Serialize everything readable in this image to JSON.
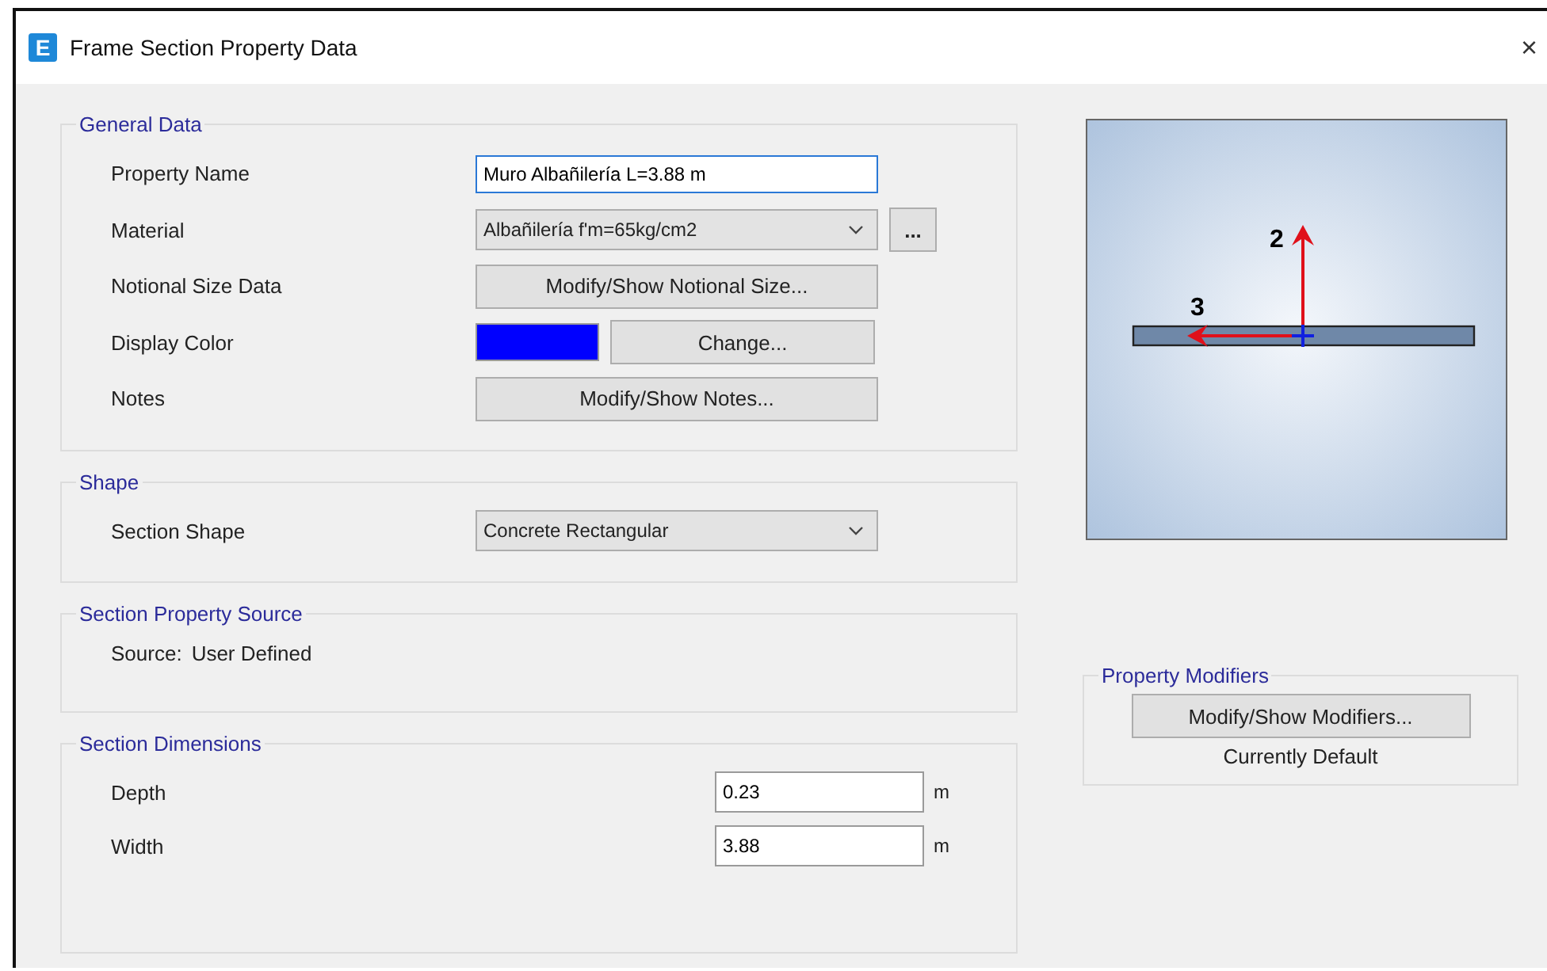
{
  "window": {
    "icon_letter": "E",
    "title": "Frame Section Property Data",
    "close": "×"
  },
  "general_data": {
    "legend": "General Data",
    "rows": [
      {
        "kind": "input",
        "label": "Property Name",
        "value": "Muro Albañilería L=3.88 m",
        "focused": true
      },
      {
        "kind": "select",
        "label": "Material",
        "value": "Albañilería f'm=65kg/cm2",
        "extra_button": "..."
      },
      {
        "kind": "button",
        "label": "Notional Size Data",
        "button": "Modify/Show Notional Size..."
      },
      {
        "kind": "color",
        "label": "Display Color",
        "color": "#0000ff",
        "button": "Change..."
      },
      {
        "kind": "button",
        "label": "Notes",
        "button": "Modify/Show Notes..."
      }
    ]
  },
  "shape": {
    "legend": "Shape",
    "label": "Section Shape",
    "value": "Concrete Rectangular"
  },
  "section_property_source": {
    "legend": "Section Property Source",
    "source_label": "Source:",
    "source_value": "User Defined"
  },
  "section_dimensions": {
    "legend": "Section Dimensions",
    "rows": [
      {
        "label": "Depth",
        "value": "0.23",
        "unit": "m"
      },
      {
        "label": "Width",
        "value": "3.88",
        "unit": "m"
      }
    ]
  },
  "preview": {
    "axis_2": "2",
    "axis_3": "3"
  },
  "property_modifiers": {
    "legend": "Property Modifiers",
    "button": "Modify/Show Modifiers...",
    "status": "Currently Default"
  }
}
